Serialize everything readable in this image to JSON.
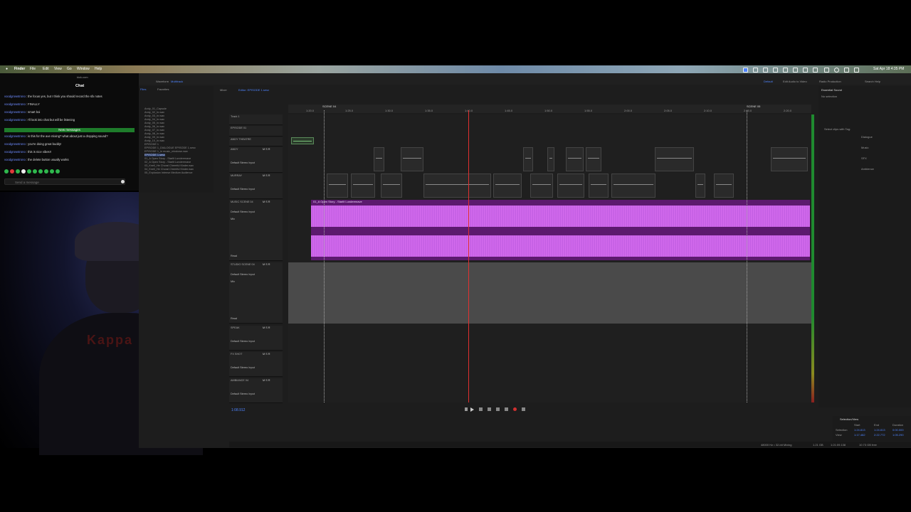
{
  "menubar": {
    "apple": "",
    "app": "Finder",
    "items": [
      "File",
      "Edit",
      "View",
      "Go",
      "Window",
      "Help"
    ],
    "clock": "Sat Apr 18 4:35 PM"
  },
  "chat": {
    "site": "kick.com",
    "title": "Chat",
    "messages": [
      {
        "user": "voodgrowstrono",
        "text": "the focus yes, but I think you should record the sfx notes"
      },
      {
        "user": "voodgrowstrono",
        "text": "FINALLY"
      },
      {
        "user": "voodgrowstrono",
        "text": "smart boi"
      },
      {
        "user": "voodgrowstrono",
        "text": "I'll look into chat but will be listening"
      },
      {
        "user": "voodgrowstrono",
        "text": "is this for the ave mixing? what about just a dropping sound?"
      },
      {
        "user": "voodgrowstrono",
        "text": "you're doing great buddy!"
      },
      {
        "user": "voodgrowstrono",
        "text": "this is nice vibes!!"
      },
      {
        "user": "voodgrowstrono",
        "text": "the delete button usually works"
      }
    ],
    "new_messages": "New messages",
    "input_placeholder": "Send a message"
  },
  "webcam": {
    "shirt_text": "Kappa"
  },
  "daw": {
    "panel_tabs": [
      "Waveform",
      "Multitrack"
    ],
    "files_tabs": [
      "Files",
      "Favorites"
    ],
    "files": [
      "Andy_01_Capsule",
      "Andy_02_In.wav",
      "Andy_03_In.wav",
      "Andy_04_In.wav",
      "Andy_05_In.wav",
      "Andy_06_In.wav",
      "Andy_07_In.wav",
      "Andy_08_In.wav",
      "Andy_09_In.wav",
      "Andy_10_In.wav",
      "EPISODE 1",
      "EPISODE 1_DIALOGUE EPISODE 1.sesx",
      "EPISODE 1_in music_mixdown.wav",
      "EPISODE 1.sesx",
      "01_A Open Story - Starlit Lunderenave",
      "02_A Open Story - Starlit Lunderenave",
      "03_Knell_He Choral Cheerful Kinder.wav",
      "04_Knell_He Choral Cheerful Kinder.wav",
      "05_Explosion Intense Medium Audience"
    ],
    "editor_tab": "Editor: EPISODE 1.sesx",
    "mixer_tab": "Mixer",
    "ruler_times": [
      "1:20.0",
      "1:25.0",
      "1:30.0",
      "1:35.0",
      "1:40.0",
      "1:45.0",
      "1:50.0",
      "1:55.0",
      "2:00.0",
      "2:05.0",
      "2:10.0",
      "2:15.0",
      "2:20.0"
    ],
    "markers": [
      "SCENE 04",
      "SCENE 05"
    ],
    "tracks": [
      {
        "name": "Track 1",
        "io": ""
      },
      {
        "name": "EPISODE 01",
        "io": ""
      },
      {
        "name": "ANDY THEATRE",
        "io": ""
      },
      {
        "name": "ANDY",
        "io": "Default Stereo Input"
      },
      {
        "name": "MURRAY",
        "io": "Default Stereo Input"
      },
      {
        "name": "MUSIC SCENE 04",
        "io": "Default Stereo Input"
      },
      {
        "name": "STUDIO SCENE 04",
        "io": "Default Stereo Input"
      },
      {
        "name": "SPEAK",
        "io": "Default Stereo Input"
      },
      {
        "name": "FX SHOT",
        "io": "Default Stereo Input"
      },
      {
        "name": "AMBIANCE 04",
        "io": "Default Stereo Input"
      }
    ],
    "music_clip_label": "01_A Open Story - Starlit Lunderenave",
    "read_label": "Read",
    "mix_label": "Mix",
    "timecode": "1:08.912",
    "right_panel": {
      "workspaces": [
        "Default",
        "Edit Audio to Video",
        "Radio Production"
      ],
      "search_placeholder": "Search Help",
      "essential_sound": "Essential Sound",
      "no_selection": "No selection",
      "select_clips": "Select clips with Tag:",
      "tags": [
        "Dialogue",
        "Music",
        "SFX",
        "Ambience"
      ]
    },
    "selection_view": {
      "title": "Selection/View",
      "headers": [
        "Start",
        "End",
        "Duration"
      ],
      "rows": [
        {
          "label": "Selection",
          "start": "1:24.813",
          "end": "1:24.813",
          "dur": "0:00.000"
        },
        {
          "label": "View",
          "start": "1:17.482",
          "end": "2:22.772",
          "dur": "1:05.290"
        }
      ]
    },
    "status": [
      "48000 Hz • 32-bit Mixing",
      "1.21 GB",
      "1:21:09.138",
      "10.73 GB free"
    ],
    "colors": {
      "music": "#c45ae6",
      "accent": "#4e84ff",
      "playhead": "#e03030",
      "chat_new": "#1e7c2b"
    }
  }
}
